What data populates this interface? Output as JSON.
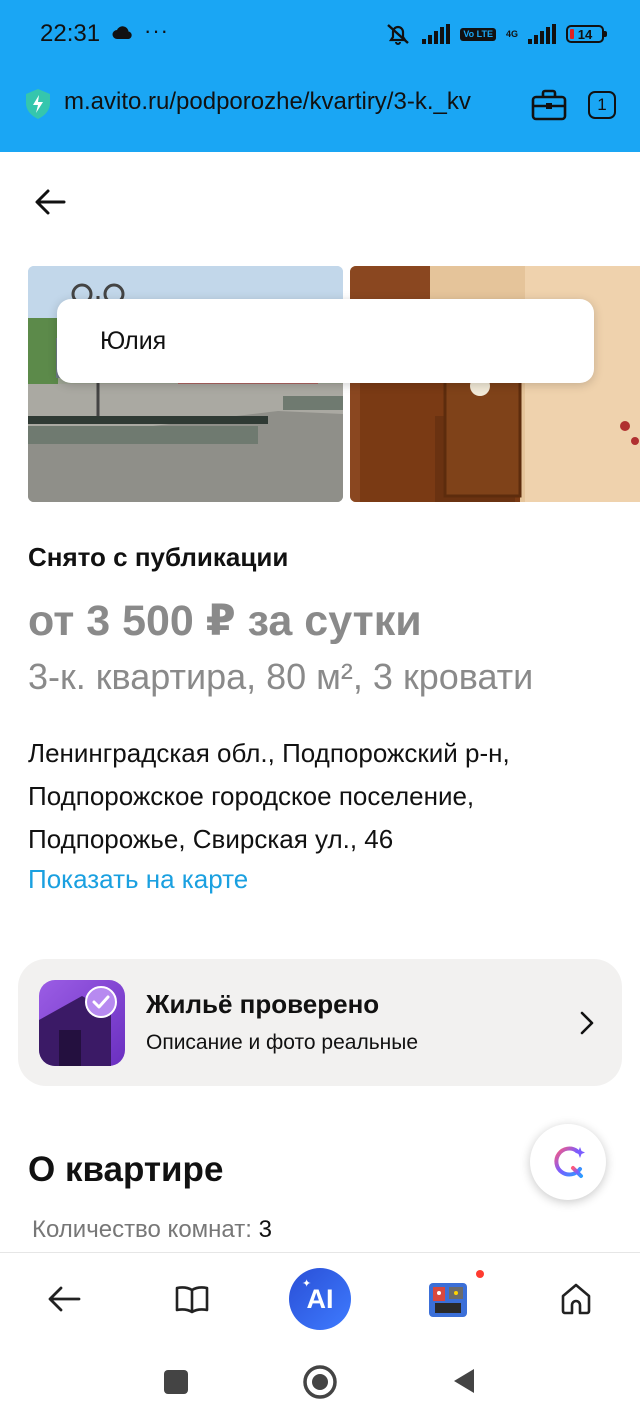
{
  "status_bar": {
    "time": "22:31",
    "dots": "···",
    "volte_label": "Vo LTE",
    "network_label": "4G",
    "battery": "14"
  },
  "address_bar": {
    "url": "m.avito.ru/podporozhe/kvartiry/3-k._kv",
    "tab_count": "1"
  },
  "seller": {
    "name": "Юлия"
  },
  "listing": {
    "status": "Снято с публикации",
    "price": "от 3 500 ₽ за сутки",
    "title": "3-к. квартира, 80 м², 3 кровати",
    "address_lines": [
      "Ленинградская обл., Подпорожский р-н,",
      "Подпорожское городское поселение,",
      "Подпорожье, Свирская ул., 46"
    ],
    "map_link": "Показать на карте"
  },
  "verified": {
    "title": "Жильё проверено",
    "subtitle": "Описание и фото реальные"
  },
  "about": {
    "title": "О квартире",
    "rooms_label": "Количество комнат:",
    "rooms_value": "3"
  },
  "browser_nav": {
    "ai_label": "AI"
  },
  "colors": {
    "topbar": "#1aa6f4",
    "link": "#1aa0e0",
    "muted_text": "#8a8a8a",
    "verified_bg": "#f2f1f0",
    "verified_icon": "#7b3fd6",
    "ai_badge": "#2a4fd6"
  },
  "icons": {
    "status": [
      "cloud-icon",
      "mute-icon",
      "signal-icon",
      "battery-icon"
    ],
    "address_bar": [
      "shield-icon",
      "briefcase-icon",
      "tabs-icon"
    ],
    "page": [
      "back-arrow-icon",
      "verified-house-icon",
      "chevron-right-icon",
      "ai-assistant-icon"
    ],
    "browser_nav": [
      "back-icon",
      "book-icon",
      "ai-icon",
      "game-avatar-icon",
      "home-icon"
    ],
    "system_nav": [
      "recents-square-icon",
      "home-circle-icon",
      "back-triangle-icon"
    ]
  }
}
